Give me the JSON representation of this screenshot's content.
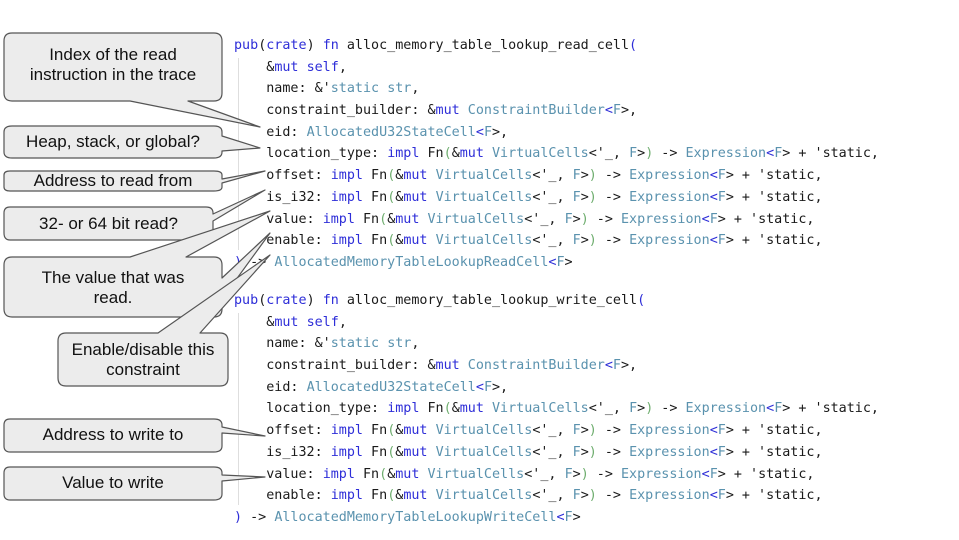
{
  "functions": [
    {
      "lines": [
        [
          [
            "kw",
            "pub"
          ],
          [
            "df",
            "("
          ],
          [
            "kw",
            "crate"
          ],
          [
            "df",
            ") "
          ],
          [
            "kw",
            "fn"
          ],
          [
            "df",
            " alloc_memory_table_lookup_read_cell"
          ],
          [
            "kw",
            "("
          ]
        ],
        [
          [
            "df",
            "    &"
          ],
          [
            "kw",
            "mut"
          ],
          [
            "df",
            " "
          ],
          [
            "kw",
            "self"
          ],
          [
            "df",
            ","
          ]
        ],
        [
          [
            "df",
            "    name: &'"
          ],
          [
            "ty",
            "static"
          ],
          [
            "df",
            " "
          ],
          [
            "ty",
            "str"
          ],
          [
            "df",
            ","
          ]
        ],
        [
          [
            "df",
            "    constraint_builder: &"
          ],
          [
            "kw",
            "mut"
          ],
          [
            "df",
            " "
          ],
          [
            "ty",
            "ConstraintBuilder"
          ],
          [
            "kw",
            "<"
          ],
          [
            "ty",
            "F"
          ],
          [
            "df",
            ">,"
          ]
        ],
        [
          [
            "df",
            "    eid: "
          ],
          [
            "ty",
            "AllocatedU32StateCell"
          ],
          [
            "kw",
            "<"
          ],
          [
            "ty",
            "F"
          ],
          [
            "df",
            ">,"
          ]
        ],
        [
          [
            "df",
            "    location_type: "
          ],
          [
            "kw",
            "impl"
          ],
          [
            "df",
            " Fn"
          ],
          [
            "pr",
            "("
          ],
          [
            "df",
            "&"
          ],
          [
            "kw",
            "mut"
          ],
          [
            "df",
            " "
          ],
          [
            "ty",
            "VirtualCells"
          ],
          [
            "df",
            "<'_, "
          ],
          [
            "ty",
            "F"
          ],
          [
            "df",
            ">"
          ],
          [
            "pr",
            ")"
          ],
          [
            "df",
            " -> "
          ],
          [
            "ty",
            "Expression"
          ],
          [
            "kw",
            "<"
          ],
          [
            "ty",
            "F"
          ],
          [
            "df",
            "> + '"
          ],
          [
            "df",
            "static,"
          ]
        ],
        [
          [
            "df",
            "    offset: "
          ],
          [
            "kw",
            "impl"
          ],
          [
            "df",
            " Fn"
          ],
          [
            "pr",
            "("
          ],
          [
            "df",
            "&"
          ],
          [
            "kw",
            "mut"
          ],
          [
            "df",
            " "
          ],
          [
            "ty",
            "VirtualCells"
          ],
          [
            "df",
            "<'_, "
          ],
          [
            "ty",
            "F"
          ],
          [
            "df",
            ">"
          ],
          [
            "pr",
            ")"
          ],
          [
            "df",
            " -> "
          ],
          [
            "ty",
            "Expression"
          ],
          [
            "kw",
            "<"
          ],
          [
            "ty",
            "F"
          ],
          [
            "df",
            "> + '"
          ],
          [
            "df",
            "static,"
          ]
        ],
        [
          [
            "df",
            "    is_i32: "
          ],
          [
            "kw",
            "impl"
          ],
          [
            "df",
            " Fn"
          ],
          [
            "pr",
            "("
          ],
          [
            "df",
            "&"
          ],
          [
            "kw",
            "mut"
          ],
          [
            "df",
            " "
          ],
          [
            "ty",
            "VirtualCells"
          ],
          [
            "df",
            "<'_, "
          ],
          [
            "ty",
            "F"
          ],
          [
            "df",
            ">"
          ],
          [
            "pr",
            ")"
          ],
          [
            "df",
            " -> "
          ],
          [
            "ty",
            "Expression"
          ],
          [
            "kw",
            "<"
          ],
          [
            "ty",
            "F"
          ],
          [
            "df",
            "> + '"
          ],
          [
            "df",
            "static,"
          ]
        ],
        [
          [
            "df",
            "    value: "
          ],
          [
            "kw",
            "impl"
          ],
          [
            "df",
            " Fn"
          ],
          [
            "pr",
            "("
          ],
          [
            "df",
            "&"
          ],
          [
            "kw",
            "mut"
          ],
          [
            "df",
            " "
          ],
          [
            "ty",
            "VirtualCells"
          ],
          [
            "df",
            "<'_, "
          ],
          [
            "ty",
            "F"
          ],
          [
            "df",
            ">"
          ],
          [
            "pr",
            ")"
          ],
          [
            "df",
            " -> "
          ],
          [
            "ty",
            "Expression"
          ],
          [
            "kw",
            "<"
          ],
          [
            "ty",
            "F"
          ],
          [
            "df",
            "> + '"
          ],
          [
            "df",
            "static,"
          ]
        ],
        [
          [
            "df",
            "    enable: "
          ],
          [
            "kw",
            "impl"
          ],
          [
            "df",
            " Fn"
          ],
          [
            "pr",
            "("
          ],
          [
            "df",
            "&"
          ],
          [
            "kw",
            "mut"
          ],
          [
            "df",
            " "
          ],
          [
            "ty",
            "VirtualCells"
          ],
          [
            "df",
            "<'_, "
          ],
          [
            "ty",
            "F"
          ],
          [
            "df",
            ">"
          ],
          [
            "pr",
            ")"
          ],
          [
            "df",
            " -> "
          ],
          [
            "ty",
            "Expression"
          ],
          [
            "kw",
            "<"
          ],
          [
            "ty",
            "F"
          ],
          [
            "df",
            "> + '"
          ],
          [
            "df",
            "static,"
          ]
        ],
        [
          [
            "kw",
            ")"
          ],
          [
            "df",
            " -> "
          ],
          [
            "ty",
            "AllocatedMemoryTableLookupReadCell"
          ],
          [
            "kw",
            "<"
          ],
          [
            "ty",
            "F"
          ],
          [
            "df",
            ">"
          ]
        ]
      ]
    },
    {
      "lines": [
        [
          [
            "kw",
            "pub"
          ],
          [
            "df",
            "("
          ],
          [
            "kw",
            "crate"
          ],
          [
            "df",
            ") "
          ],
          [
            "kw",
            "fn"
          ],
          [
            "df",
            " alloc_memory_table_lookup_write_cell"
          ],
          [
            "kw",
            "("
          ]
        ],
        [
          [
            "df",
            "    &"
          ],
          [
            "kw",
            "mut"
          ],
          [
            "df",
            " "
          ],
          [
            "kw",
            "self"
          ],
          [
            "df",
            ","
          ]
        ],
        [
          [
            "df",
            "    name: &'"
          ],
          [
            "ty",
            "static"
          ],
          [
            "df",
            " "
          ],
          [
            "ty",
            "str"
          ],
          [
            "df",
            ","
          ]
        ],
        [
          [
            "df",
            "    constraint_builder: &"
          ],
          [
            "kw",
            "mut"
          ],
          [
            "df",
            " "
          ],
          [
            "ty",
            "ConstraintBuilder"
          ],
          [
            "kw",
            "<"
          ],
          [
            "ty",
            "F"
          ],
          [
            "df",
            ">,"
          ]
        ],
        [
          [
            "df",
            "    eid: "
          ],
          [
            "ty",
            "AllocatedU32StateCell"
          ],
          [
            "kw",
            "<"
          ],
          [
            "ty",
            "F"
          ],
          [
            "df",
            ">,"
          ]
        ],
        [
          [
            "df",
            "    location_type: "
          ],
          [
            "kw",
            "impl"
          ],
          [
            "df",
            " Fn"
          ],
          [
            "pr",
            "("
          ],
          [
            "df",
            "&"
          ],
          [
            "kw",
            "mut"
          ],
          [
            "df",
            " "
          ],
          [
            "ty",
            "VirtualCells"
          ],
          [
            "df",
            "<'_, "
          ],
          [
            "ty",
            "F"
          ],
          [
            "df",
            ">"
          ],
          [
            "pr",
            ")"
          ],
          [
            "df",
            " -> "
          ],
          [
            "ty",
            "Expression"
          ],
          [
            "kw",
            "<"
          ],
          [
            "ty",
            "F"
          ],
          [
            "df",
            "> + '"
          ],
          [
            "df",
            "static,"
          ]
        ],
        [
          [
            "df",
            "    offset: "
          ],
          [
            "kw",
            "impl"
          ],
          [
            "df",
            " Fn"
          ],
          [
            "pr",
            "("
          ],
          [
            "df",
            "&"
          ],
          [
            "kw",
            "mut"
          ],
          [
            "df",
            " "
          ],
          [
            "ty",
            "VirtualCells"
          ],
          [
            "df",
            "<'_, "
          ],
          [
            "ty",
            "F"
          ],
          [
            "df",
            ">"
          ],
          [
            "pr",
            ")"
          ],
          [
            "df",
            " -> "
          ],
          [
            "ty",
            "Expression"
          ],
          [
            "kw",
            "<"
          ],
          [
            "ty",
            "F"
          ],
          [
            "df",
            "> + '"
          ],
          [
            "df",
            "static,"
          ]
        ],
        [
          [
            "df",
            "    is_i32: "
          ],
          [
            "kw",
            "impl"
          ],
          [
            "df",
            " Fn"
          ],
          [
            "pr",
            "("
          ],
          [
            "df",
            "&"
          ],
          [
            "kw",
            "mut"
          ],
          [
            "df",
            " "
          ],
          [
            "ty",
            "VirtualCells"
          ],
          [
            "df",
            "<'_, "
          ],
          [
            "ty",
            "F"
          ],
          [
            "df",
            ">"
          ],
          [
            "pr",
            ")"
          ],
          [
            "df",
            " -> "
          ],
          [
            "ty",
            "Expression"
          ],
          [
            "kw",
            "<"
          ],
          [
            "ty",
            "F"
          ],
          [
            "df",
            "> + '"
          ],
          [
            "df",
            "static,"
          ]
        ],
        [
          [
            "df",
            "    value: "
          ],
          [
            "kw",
            "impl"
          ],
          [
            "df",
            " Fn"
          ],
          [
            "pr",
            "("
          ],
          [
            "df",
            "&"
          ],
          [
            "kw",
            "mut"
          ],
          [
            "df",
            " "
          ],
          [
            "ty",
            "VirtualCells"
          ],
          [
            "df",
            "<'_, "
          ],
          [
            "ty",
            "F"
          ],
          [
            "df",
            ">"
          ],
          [
            "pr",
            ")"
          ],
          [
            "df",
            " -> "
          ],
          [
            "ty",
            "Expression"
          ],
          [
            "kw",
            "<"
          ],
          [
            "ty",
            "F"
          ],
          [
            "df",
            "> + '"
          ],
          [
            "df",
            "static,"
          ]
        ],
        [
          [
            "df",
            "    enable: "
          ],
          [
            "kw",
            "impl"
          ],
          [
            "df",
            " Fn"
          ],
          [
            "pr",
            "("
          ],
          [
            "df",
            "&"
          ],
          [
            "kw",
            "mut"
          ],
          [
            "df",
            " "
          ],
          [
            "ty",
            "VirtualCells"
          ],
          [
            "df",
            "<'_, "
          ],
          [
            "ty",
            "F"
          ],
          [
            "df",
            ">"
          ],
          [
            "pr",
            ")"
          ],
          [
            "df",
            " -> "
          ],
          [
            "ty",
            "Expression"
          ],
          [
            "kw",
            "<"
          ],
          [
            "ty",
            "F"
          ],
          [
            "df",
            "> + '"
          ],
          [
            "df",
            "static,"
          ]
        ],
        [
          [
            "kw",
            ")"
          ],
          [
            "df",
            " -> "
          ],
          [
            "ty",
            "AllocatedMemoryTableLookupWriteCell"
          ],
          [
            "kw",
            "<"
          ],
          [
            "ty",
            "F"
          ],
          [
            "df",
            ">"
          ]
        ]
      ]
    }
  ],
  "callouts": {
    "read_index": "Index of the read instruction in the trace",
    "read_location": "Heap, stack, or global?",
    "read_address": "Address to read from",
    "read_width": "32- or 64 bit read?",
    "read_value": "The value that was read.",
    "read_enable": "Enable/disable this constraint",
    "write_address": "Address to write to",
    "write_value": "Value to write"
  },
  "colors": {
    "keyword": "#2e2ed8",
    "type": "#5a92ae",
    "paren": "#6fae6f",
    "callout_fill": "#ececec",
    "callout_stroke": "#555555"
  }
}
